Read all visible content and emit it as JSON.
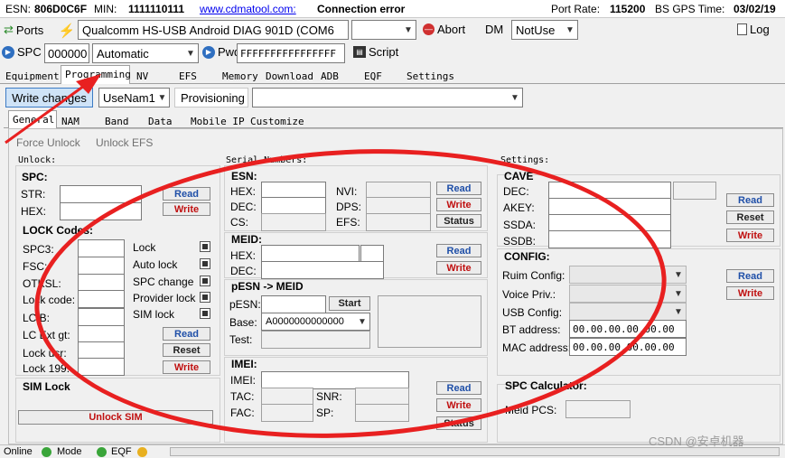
{
  "header": {
    "esn_label": "ESN:",
    "esn_value": "806D0C6F",
    "min_label": "MIN:",
    "min_value": "1111110111",
    "site": "www.cdmatool.com:",
    "connection_status": "Connection error",
    "port_rate_label": "Port Rate:",
    "port_rate_value": "115200",
    "gps_label": "BS GPS Time:",
    "gps_value": "03/02/19"
  },
  "toolbar1": {
    "ports_label": "Ports",
    "device": "Qualcomm HS-USB Android DIAG 901D (COM6",
    "abort_label": "Abort",
    "dm_label": "DM",
    "dm_value": "NotUse",
    "log_label": "Log"
  },
  "toolbar2": {
    "spc_label": "SPC",
    "spc_value": "000000",
    "mode": "Automatic",
    "pwd_label": "Pwd",
    "pwd_value": "FFFFFFFFFFFFFFFF",
    "script_label": "Script"
  },
  "main_tabs": [
    "Equipment",
    "Programming",
    "NV",
    "EFS",
    "Memory",
    "Download",
    "ADB",
    "EQF",
    "Settings"
  ],
  "action_bar": {
    "write_changes": "Write changes",
    "user": "UseNam1",
    "provisioning": "Provisioning"
  },
  "sub_tabs": [
    "General",
    "NAM",
    "Band",
    "Data",
    "Mobile IP",
    "Customize"
  ],
  "links": {
    "force_unlock": "Force Unlock",
    "unlock_efs": "Unlock EFS"
  },
  "unlock": {
    "title": "Unlock:",
    "spc_header": "SPC:",
    "str_label": "STR:",
    "hex_label": "HEX:",
    "read": "Read",
    "write": "Write",
    "lock_codes_header": "LOCK Codes:",
    "codes": [
      "SPC3:",
      "FSC:",
      "OTKSL:",
      "Lock code:",
      "LC B:",
      "LC Ext gt:",
      "Lock usr:",
      "Lock 199:"
    ],
    "checks": [
      "Lock",
      "Auto lock",
      "SPC change",
      "Provider lock",
      "SIM lock"
    ],
    "reset": "Reset",
    "sim_lock_header": "SIM Lock",
    "unlock_sim": "Unlock SIM"
  },
  "serial": {
    "title": "Serial Numbers:",
    "esn_header": "ESN:",
    "hex": "HEX:",
    "dec": "DEC:",
    "cs": "CS:",
    "nvi": "NVI:",
    "dps": "DPS:",
    "efs": "EFS:",
    "read": "Read",
    "write": "Write",
    "status": "Status",
    "meid_header": "MEID:",
    "pesn_header": "pESN -> MEID",
    "pesn_label": "pESN:",
    "start": "Start",
    "base_label": "Base:",
    "base_value": "A0000000000000",
    "test_label": "Test:",
    "imei_header": "IMEI:",
    "imei_label": "IMEI:",
    "tac_label": "TAC:",
    "fac_label": "FAC:",
    "snr_label": "SNR:",
    "sp_label": "SP:"
  },
  "settings": {
    "title": "Settings:",
    "cave_header": "CAVE",
    "dec": "DEC:",
    "akey": "AKEY:",
    "ssda": "SSDA:",
    "ssdb": "SSDB:",
    "read": "Read",
    "reset": "Reset",
    "write": "Write",
    "config_header": "CONFIG:",
    "ruim": "Ruim Config:",
    "voice": "Voice Priv.:",
    "usb": "USB Config:",
    "bt_label": "BT address:",
    "bt_value": "00.00.00.00.00.00",
    "mac_label": "MAC address:",
    "mac_value": "00.00.00.00.00.00",
    "spc_calc_header": "SPC Calculator:",
    "meid_pcs": "Meid PCS:"
  },
  "status_bar": {
    "online": "Online",
    "mode": "Mode",
    "eqf": "EQF"
  },
  "watermark": "CSDN @安卓机器",
  "colors": {
    "annotation": "#e82020",
    "link": "#0000ee",
    "write": "#c01010",
    "read": "#1f4fa8"
  }
}
